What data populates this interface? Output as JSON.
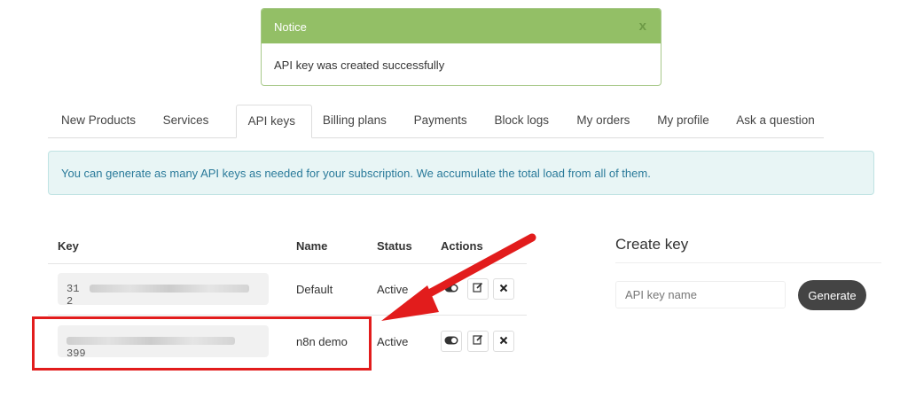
{
  "notice": {
    "title": "Notice",
    "close_label": "x",
    "message": "API key was created successfully"
  },
  "tabs": [
    {
      "label": "New Products",
      "active": false
    },
    {
      "label": "Services",
      "active": false
    },
    {
      "label": "API keys",
      "active": true
    },
    {
      "label": "Billing plans",
      "active": false
    },
    {
      "label": "Payments",
      "active": false
    },
    {
      "label": "Block logs",
      "active": false
    },
    {
      "label": "My orders",
      "active": false
    },
    {
      "label": "My profile",
      "active": false
    },
    {
      "label": "Ask a question",
      "active": false
    }
  ],
  "info_message": "You can generate as many API keys as needed for your subscription. We accumulate the total load from all of them.",
  "table": {
    "headers": {
      "key": "Key",
      "name": "Name",
      "status": "Status",
      "actions": "Actions"
    },
    "rows": [
      {
        "key_start": "31",
        "key_end": "2",
        "name": "Default",
        "status": "Active"
      },
      {
        "key_start": "",
        "key_end": "399",
        "name": "n8n demo",
        "status": "Active"
      }
    ]
  },
  "create_key": {
    "title": "Create key",
    "input_placeholder": "API key name",
    "button_label": "Generate"
  },
  "colors": {
    "notice_header": "#93bf66",
    "highlight": "#e21c1c",
    "generate_button": "#444444",
    "info_text": "#2a7a9a"
  }
}
